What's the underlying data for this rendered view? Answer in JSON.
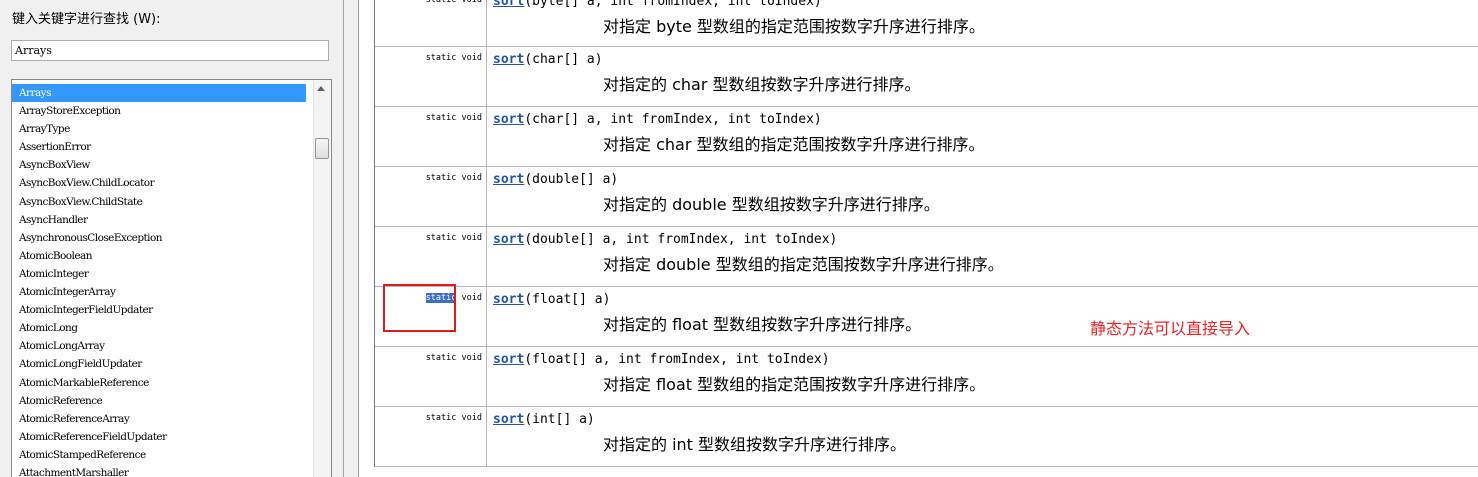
{
  "index_panel": {
    "search_label": "键入关键字进行查找 (W):",
    "search_value": "Arrays",
    "items": [
      "Arrays",
      "ArrayStoreException",
      "ArrayType",
      "AssertionError",
      "AsyncBoxView",
      "AsyncBoxView.ChildLocator",
      "AsyncBoxView.ChildState",
      "AsyncHandler",
      "AsynchronousCloseException",
      "AtomicBoolean",
      "AtomicInteger",
      "AtomicIntegerArray",
      "AtomicIntegerFieldUpdater",
      "AtomicLong",
      "AtomicLongArray",
      "AtomicLongFieldUpdater",
      "AtomicMarkableReference",
      "AtomicReference",
      "AtomicReferenceArray",
      "AtomicReferenceFieldUpdater",
      "AtomicStampedReference",
      "AttachmentMarshaller"
    ],
    "selected_item": "Arrays"
  },
  "methods": [
    {
      "modifier_a": "static",
      "modifier_b": " void",
      "name": "sort",
      "params": "(byte[] a, int fromIndex, int toIndex)",
      "desc": "对指定 byte 型数组的指定范围按数字升序进行排序。"
    },
    {
      "modifier_a": "static",
      "modifier_b": " void",
      "name": "sort",
      "params": "(char[] a)",
      "desc": "对指定的 char 型数组按数字升序进行排序。"
    },
    {
      "modifier_a": "static",
      "modifier_b": " void",
      "name": "sort",
      "params": "(char[] a, int fromIndex, int toIndex)",
      "desc": "对指定 char 型数组的指定范围按数字升序进行排序。"
    },
    {
      "modifier_a": "static",
      "modifier_b": " void",
      "name": "sort",
      "params": "(double[] a)",
      "desc": "对指定的 double 型数组按数字升序进行排序。"
    },
    {
      "modifier_a": "static",
      "modifier_b": " void",
      "name": "sort",
      "params": "(double[] a, int fromIndex, int toIndex)",
      "desc": "对指定 double 型数组的指定范围按数字升序进行排序。"
    },
    {
      "modifier_a": "static",
      "modifier_b": " void",
      "name": "sort",
      "params": "(float[] a)",
      "desc": "对指定的 float 型数组按数字升序进行排序。",
      "highlighted": true
    },
    {
      "modifier_a": "static",
      "modifier_b": " void",
      "name": "sort",
      "params": "(float[] a, int fromIndex, int toIndex)",
      "desc": "对指定 float 型数组的指定范围按数字升序进行排序。"
    },
    {
      "modifier_a": "static",
      "modifier_b": " void",
      "name": "sort",
      "params": "(int[] a)",
      "desc": "对指定的 int 型数组按数字升序进行排序。"
    }
  ],
  "annotation": {
    "text": "静态方法可以直接导入",
    "color": "#ee2222"
  },
  "colors": {
    "link": "#2255aa",
    "selection": "#3399ff",
    "highlight_box": "#e0191b"
  }
}
